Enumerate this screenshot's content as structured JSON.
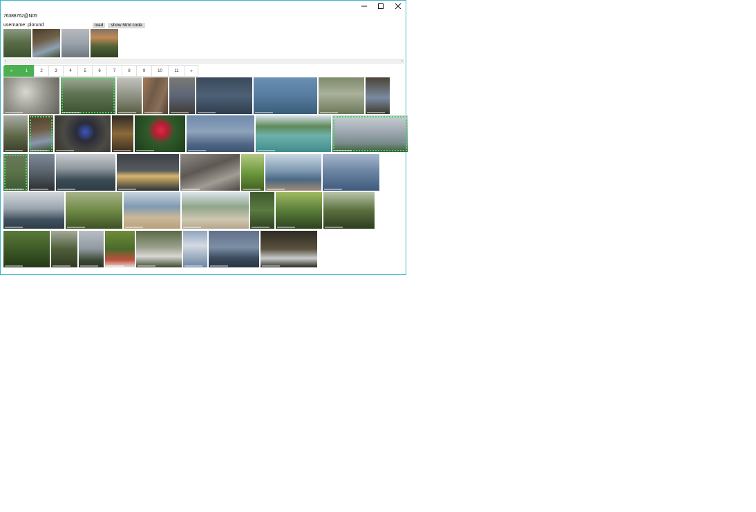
{
  "window": {
    "minimize_glyph": "minimize-icon",
    "maximize_glyph": "maximize-icon",
    "close_glyph": "close-icon"
  },
  "header": {
    "user_id": "76388762@N05",
    "username_label": "username: plorund",
    "load_label": "load",
    "show_html_label": "show html code"
  },
  "pager": {
    "items": [
      "«",
      "1",
      "2",
      "3",
      "4",
      "5",
      "6",
      "7",
      "8",
      "9",
      "10",
      "11",
      "»"
    ],
    "active": "1"
  },
  "colors": {
    "accent": "#4caf50",
    "selection": "#3cd75a",
    "window_border": "#3bb6c7"
  },
  "selected_photos": [
    {
      "name": "palm-forest",
      "bg": "linear-gradient(180deg,#8a9a80 0%,#5a6e48 45%,#3d5230 100%)"
    },
    {
      "name": "child-forest",
      "bg": "linear-gradient(160deg,#4a3c2c 0%,#6f6048 40%,#8fa0b2 70%,#3f4a2c 100%)"
    },
    {
      "name": "sea-sunset-boat",
      "bg": "linear-gradient(180deg,#b7b9bd 0%,#9aa2ab 50%,#6e7881 100%)"
    },
    {
      "name": "forest-sunset",
      "bg": "linear-gradient(180deg,#7f7464 0%,#c08a55 30%,#546338 60%,#30401f 100%)"
    }
  ],
  "gallery": [
    {
      "name": "white-blossoms",
      "bg": "radial-gradient(circle at 40% 40%,#d8d8d2 0%,#9b9b93 45%,#5e5f58 100%)",
      "selected": false
    },
    {
      "name": "palm-forest",
      "bg": "linear-gradient(180deg,#a0aa98 0%,#5f7352 45%,#3a5130 100%)",
      "selected": true
    },
    {
      "name": "field-trees",
      "bg": "linear-gradient(180deg,#c2c3bf 0%,#8e9283 50%,#585c42 100%)",
      "selected": false
    },
    {
      "name": "tree-bark",
      "bg": "linear-gradient(110deg,#a57c5a 0%,#6f5a48 40%,#8b6f58 70%,#4e4034 100%)",
      "selected": false
    },
    {
      "name": "family-portrait",
      "bg": "linear-gradient(180deg,#7a7a72 0%,#5d6678 50%,#3f3a34 100%)",
      "selected": false
    },
    {
      "name": "duck-water",
      "bg": "linear-gradient(180deg,#3a4a5c 0%,#4d6075 50%,#2f3d4e 100%)",
      "selected": false
    },
    {
      "name": "ducks-lake",
      "bg": "linear-gradient(180deg,#6b8fb5 0%,#567c9f 50%,#3a5c7a 100%)",
      "selected": false
    },
    {
      "name": "reflection-lake",
      "bg": "linear-gradient(180deg,#7d8a6b 0%,#a9b09a 45%,#6d7758 100%)",
      "selected": false
    },
    {
      "name": "child-dark",
      "bg": "linear-gradient(180deg,#4b4234 0%,#7a8ba0 55%,#3b3a2e 100%)",
      "selected": false
    },
    {
      "name": "tall-tree",
      "bg": "linear-gradient(180deg,#a8aca6 0%,#5f6948 55%,#3a3f2a 100%)",
      "selected": false
    },
    {
      "name": "child-forest",
      "bg": "linear-gradient(170deg,#4c3e2d 0%,#6e5c45 40%,#8898ad 70%,#3c4529 100%)",
      "selected": true
    },
    {
      "name": "blue-flowers",
      "bg": "radial-gradient(circle at 55% 45%,#3b56c4 0%,#2a2c38 25%,#4c4a44 60%,#35322c 100%)",
      "selected": false
    },
    {
      "name": "whisky-bottle",
      "bg": "linear-gradient(180deg,#2e2a26 0%,#8a6a3a 50%,#3a2e20 100%)",
      "selected": false
    },
    {
      "name": "red-hibiscus",
      "bg": "radial-gradient(circle at 52% 40%,#e02a45 0%,#b81e36 18%,#2f5a2a 40%,#1e3a1a 100%)",
      "selected": false
    },
    {
      "name": "cloudy-sea",
      "bg": "linear-gradient(180deg,#6f8aab 0%,#8ea2bb 45%,#4d6584 80%,#3e5370 100%)",
      "selected": false
    },
    {
      "name": "green-bay",
      "bg": "linear-gradient(180deg,#d6e2ea 0%,#5f8a5a 30%,#6fb1ac 55%,#3f8d8c 100%)",
      "selected": false
    },
    {
      "name": "sailboat-clouds",
      "bg": "linear-gradient(180deg,#c9cfd4 0%,#9ea7b0 45%,#7a8e8f 75%,#3f5e3a 100%)",
      "selected": true
    },
    {
      "name": "coast-green",
      "bg": "linear-gradient(180deg,#6b7a5c 0%,#5a7248 50%,#3f5733 100%)",
      "selected": true
    },
    {
      "name": "rocky-sunset",
      "bg": "linear-gradient(180deg,#7d8a96 0%,#5c6670 45%,#2a2e30 100%)",
      "selected": false
    },
    {
      "name": "island-sea",
      "bg": "linear-gradient(180deg,#c8ccd0 0%,#8e969c 40%,#3b4c55 70%,#2e3d44 100%)",
      "selected": false
    },
    {
      "name": "dark-horizon",
      "bg": "linear-gradient(180deg,#3c4148 0%,#565b5e 45%,#d9b56c 60%,#2c3236 100%)",
      "selected": false
    },
    {
      "name": "rock-crab",
      "bg": "linear-gradient(160deg,#8f8a84 0%,#5d5853 40%,#a29c95 70%,#4c4742 100%)",
      "selected": false
    },
    {
      "name": "banana-leaves",
      "bg": "linear-gradient(180deg,#b6c886 0%,#6e9a3c 50%,#405e22 100%)",
      "selected": false
    },
    {
      "name": "beach-waves",
      "bg": "linear-gradient(180deg,#c9d6e2 0%,#7f9ab1 45%,#4b6882 70%,#a08c74 100%)",
      "selected": false
    },
    {
      "name": "person-sea",
      "bg": "linear-gradient(180deg,#a6b7cc 0%,#6e86a4 45%,#3e5a7c 100%)",
      "selected": false
    },
    {
      "name": "stormy-waves",
      "bg": "linear-gradient(180deg,#d2d7dc 0%,#9aa4ae 45%,#42515f 75%,#2e3b48 100%)",
      "selected": false
    },
    {
      "name": "coconut-palm",
      "bg": "linear-gradient(180deg,#a8b38a 0%,#6f8a46 50%,#3e5026 100%)",
      "selected": false
    },
    {
      "name": "sandy-beach",
      "bg": "linear-gradient(180deg,#c9d4de 0%,#7e9ab2 40%,#cbb898 70%,#b8a07c 100%)",
      "selected": false
    },
    {
      "name": "palm-beach",
      "bg": "linear-gradient(180deg,#dce4ea 0%,#8fa58a 40%,#d0c7b2 75%,#b3a68a 100%)",
      "selected": false
    },
    {
      "name": "garden-post",
      "bg": "linear-gradient(180deg,#3e5a2e 0%,#5a7b40 50%,#2c3f1f 100%)",
      "selected": false
    },
    {
      "name": "parrot-branch",
      "bg": "linear-gradient(180deg,#9fba62 0%,#5b7d3a 50%,#2c4320 100%)",
      "selected": false
    },
    {
      "name": "birds-tree",
      "bg": "linear-gradient(180deg,#b8c4a8 0%,#5a6f3e 50%,#2e3d20 100%)",
      "selected": false
    },
    {
      "name": "jungle-monkey",
      "bg": "linear-gradient(180deg,#5a7a3a 0%,#3e5a26 50%,#243818 100%)",
      "selected": false
    },
    {
      "name": "monkey-tree",
      "bg": "linear-gradient(180deg,#a4aa9a 0%,#4f5e3a 50%,#2f3a22 100%)",
      "selected": false
    },
    {
      "name": "grey-sky",
      "bg": "linear-gradient(180deg,#b8bec6 0%,#8f979f 50%,#3d4a36 80%,#2b3426 100%)",
      "selected": false
    },
    {
      "name": "red-roof",
      "bg": "linear-gradient(180deg,#6f8c3a 0%,#4a6a2a 50%,#c0503c 80%,#e4e2dc 100%)",
      "selected": false
    },
    {
      "name": "bird-roof",
      "bg": "linear-gradient(180deg,#5a6a48 0%,#9aa08c 45%,#d8d8d2 70%,#3d4a30 100%)",
      "selected": false
    },
    {
      "name": "cloud-sky",
      "bg": "linear-gradient(180deg,#8fa4c0 0%,#d4dae2 40%,#6b83a3 100%)",
      "selected": false
    },
    {
      "name": "dusk-island",
      "bg": "linear-gradient(180deg,#5f7088 0%,#7d8fa6 45%,#3a4a5e 75%,#2a3544 100%)",
      "selected": false
    },
    {
      "name": "statue-forest",
      "bg": "linear-gradient(180deg,#2e2b22 0%,#5a5240 50%,#c8cccc 75%,#2a2820 100%)",
      "selected": false
    }
  ]
}
